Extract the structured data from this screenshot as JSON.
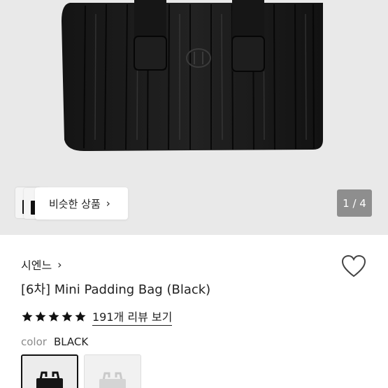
{
  "gallery": {
    "similar_button_label": "비슷한 상품",
    "similar_chevron": "›",
    "page_counter": "1 / 4"
  },
  "product": {
    "brand": "시엔느",
    "brand_chevron": "›",
    "title": "[6차] Mini Padding Bag (Black)",
    "rating_stars": 5,
    "review_link": "191개 리뷰 보기",
    "color_label": "color",
    "color_value": "BLACK"
  },
  "colors": {
    "bag": "#1a1a1a",
    "background": "#e9e9e9",
    "counter_bg": "#8e8e8e",
    "star": "#111111"
  },
  "icons": {
    "wishlist": "heart-outline-icon",
    "star": "star-icon",
    "chevron": "chevron-right-icon"
  }
}
